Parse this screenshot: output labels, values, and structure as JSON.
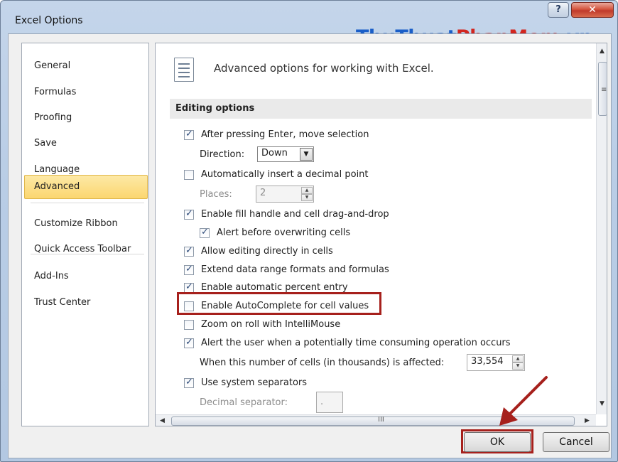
{
  "window": {
    "title": "Excel Options",
    "help_glyph": "?",
    "close_glyph": "✕"
  },
  "watermark": {
    "part1": "ThuThuat",
    "part2": "PhanMem",
    "part3": ".vn"
  },
  "nav": {
    "items": [
      {
        "label": "General"
      },
      {
        "label": "Formulas"
      },
      {
        "label": "Proofing"
      },
      {
        "label": "Save"
      },
      {
        "label": "Language"
      },
      {
        "label": "Advanced",
        "selected": true
      },
      {
        "label": "Customize Ribbon"
      },
      {
        "label": "Quick Access Toolbar"
      },
      {
        "label": "Add-Ins"
      },
      {
        "label": "Trust Center"
      }
    ]
  },
  "panel": {
    "heading": "Advanced options for working with Excel.",
    "section": "Editing options",
    "options": {
      "after_enter": {
        "label": "After pressing Enter, move selection",
        "checked": true
      },
      "direction_label": "Direction:",
      "direction_value": "Down",
      "auto_decimal": {
        "label": "Automatically insert a decimal point",
        "checked": false
      },
      "places_label": "Places:",
      "places_value": "2",
      "fill_handle": {
        "label": "Enable fill handle and cell drag-and-drop",
        "checked": true
      },
      "alert_overwrite": {
        "label": "Alert before overwriting cells",
        "checked": true
      },
      "edit_in_cells": {
        "label": "Allow editing directly in cells",
        "checked": true
      },
      "extend_formats": {
        "label": "Extend data range formats and formulas",
        "checked": true
      },
      "auto_percent": {
        "label": "Enable automatic percent entry",
        "checked": true
      },
      "autocomplete": {
        "label": "Enable AutoComplete for cell values",
        "checked": false
      },
      "zoom_roll": {
        "label": "Zoom on roll with IntelliMouse",
        "checked": false
      },
      "alert_time": {
        "label": "Alert the user when a potentially time consuming operation occurs",
        "checked": true
      },
      "cells_label": "When this number of cells (in thousands) is affected:",
      "cells_value": "33,554",
      "system_separators": {
        "label": "Use system separators",
        "checked": true
      },
      "decimal_separator_label": "Decimal separator:",
      "decimal_separator_value": "."
    },
    "hscroll_grip": "III",
    "vscroll_grip": "≡"
  },
  "footer": {
    "ok_label": "OK",
    "cancel_label": "Cancel"
  },
  "colors": {
    "highlight": "#a6201c",
    "selected_nav": "#fbd670"
  }
}
